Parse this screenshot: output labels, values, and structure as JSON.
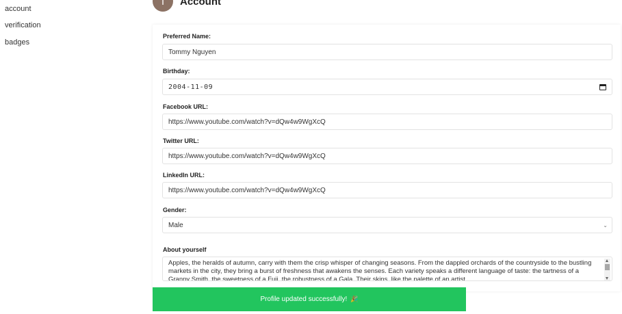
{
  "sidebar": {
    "items": [
      {
        "label": "account"
      },
      {
        "label": "verification"
      },
      {
        "label": "badges"
      }
    ]
  },
  "header": {
    "avatar_initial": "T",
    "title": "Account"
  },
  "form": {
    "preferred_name": {
      "label": "Preferred Name:",
      "value": "Tommy Nguyen"
    },
    "birthday": {
      "label": "Birthday:",
      "value": "2004-11-09"
    },
    "facebook": {
      "label": "Facebook URL:",
      "value": "https://www.youtube.com/watch?v=dQw4w9WgXcQ"
    },
    "twitter": {
      "label": "Twitter URL:",
      "value": "https://www.youtube.com/watch?v=dQw4w9WgXcQ"
    },
    "linkedin": {
      "label": "LinkedIn URL:",
      "value": "https://www.youtube.com/watch?v=dQw4w9WgXcQ"
    },
    "gender": {
      "label": "Gender:",
      "value": "Male"
    },
    "about": {
      "label": "About yourself",
      "value": "Apples, the heralds of autumn, carry with them the crisp whisper of changing seasons. From the dappled orchards of the countryside to the bustling markets in the city, they bring a burst of freshness that awakens the senses. Each variety speaks a different language of taste: the tartness of a Granny Smith, the sweetness of a Fuji, the robustness of a Gala. Their skins, like the palette of an artist"
    }
  },
  "toast": {
    "message": "Profile updated successfully!",
    "icon": "party-popper-icon"
  },
  "colors": {
    "toast_bg": "#22c55e",
    "avatar_bg": "#8c7264"
  }
}
